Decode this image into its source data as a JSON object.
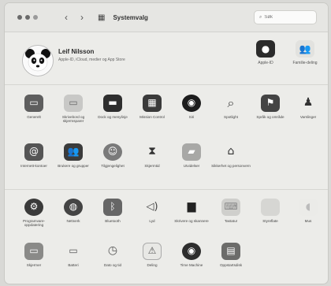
{
  "window": {
    "title": "Systemvalg",
    "search_placeholder": "Søk"
  },
  "account": {
    "name": "Leif Nilsson",
    "subtitle": "Apple-ID, iCloud, medier og App Store",
    "apple_id_label": "Apple-ID",
    "family_label": "Familie-deling"
  },
  "row1": [
    {
      "label": "Generelt",
      "icon": "generelt-icon"
    },
    {
      "label": "Skrivebord og skjermsparer",
      "icon": "desktop-icon"
    },
    {
      "label": "Dock og menylinje",
      "icon": "dock-icon"
    },
    {
      "label": "Mission Control",
      "icon": "mission-control-icon"
    },
    {
      "label": "Siri",
      "icon": "siri-icon"
    },
    {
      "label": "Spotlight",
      "icon": "spotlight-icon"
    },
    {
      "label": "Språk og område",
      "icon": "language-icon"
    },
    {
      "label": "Varslinger",
      "icon": "notifications-icon"
    }
  ],
  "row2": [
    {
      "label": "Internett-kontoer",
      "icon": "internet-accounts-icon"
    },
    {
      "label": "Brukere og grupper",
      "icon": "users-icon"
    },
    {
      "label": "Tilgjengelighet",
      "icon": "accessibility-icon"
    },
    {
      "label": "Skjermtid",
      "icon": "screen-time-icon"
    },
    {
      "label": "Utvidelser",
      "icon": "extensions-icon"
    },
    {
      "label": "Sikkerhet og personvern",
      "icon": "security-icon"
    }
  ],
  "row3": [
    {
      "label": "Programvare-oppdatering",
      "icon": "software-update-icon"
    },
    {
      "label": "Nettverk",
      "icon": "network-icon"
    },
    {
      "label": "Bluetooth",
      "icon": "bluetooth-icon"
    },
    {
      "label": "Lyd",
      "icon": "sound-icon"
    },
    {
      "label": "Skrivere og skannere",
      "icon": "printer-icon"
    },
    {
      "label": "Tastatur",
      "icon": "keyboard-icon"
    },
    {
      "label": "Styreflate",
      "icon": "trackpad-icon"
    },
    {
      "label": "Mus",
      "icon": "mouse-icon"
    }
  ],
  "row4": [
    {
      "label": "Skjermer",
      "icon": "displays-icon"
    },
    {
      "label": "Batteri",
      "icon": "battery-icon"
    },
    {
      "label": "Dato og tid",
      "icon": "date-time-icon"
    },
    {
      "label": "Deling",
      "icon": "sharing-icon"
    },
    {
      "label": "Time Machine",
      "icon": "time-machine-icon"
    },
    {
      "label": "Oppstartsdisk",
      "icon": "startup-disk-icon"
    }
  ]
}
